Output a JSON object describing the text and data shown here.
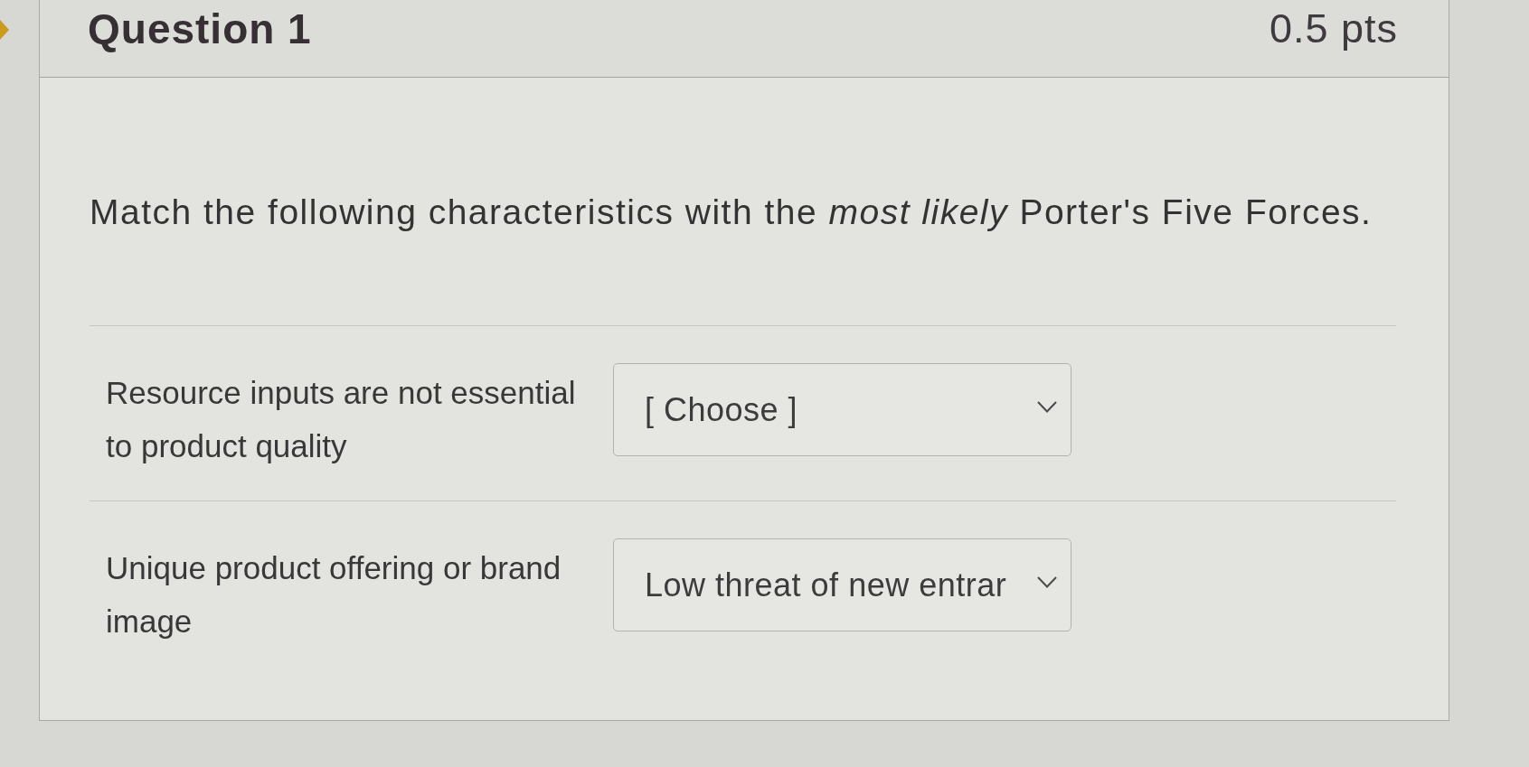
{
  "question": {
    "title": "Question 1",
    "points": "0.5 pts",
    "prompt": "Match the following characteristics with the *most likely* Porter's Five Forces."
  },
  "matches": [
    {
      "label": "Resource inputs are not essential to product quality",
      "answer": {
        "value": "[ Choose ]"
      }
    },
    {
      "label": "Unique product offering or brand image",
      "answer": {
        "value": "Low threat of new entrar"
      }
    }
  ]
}
